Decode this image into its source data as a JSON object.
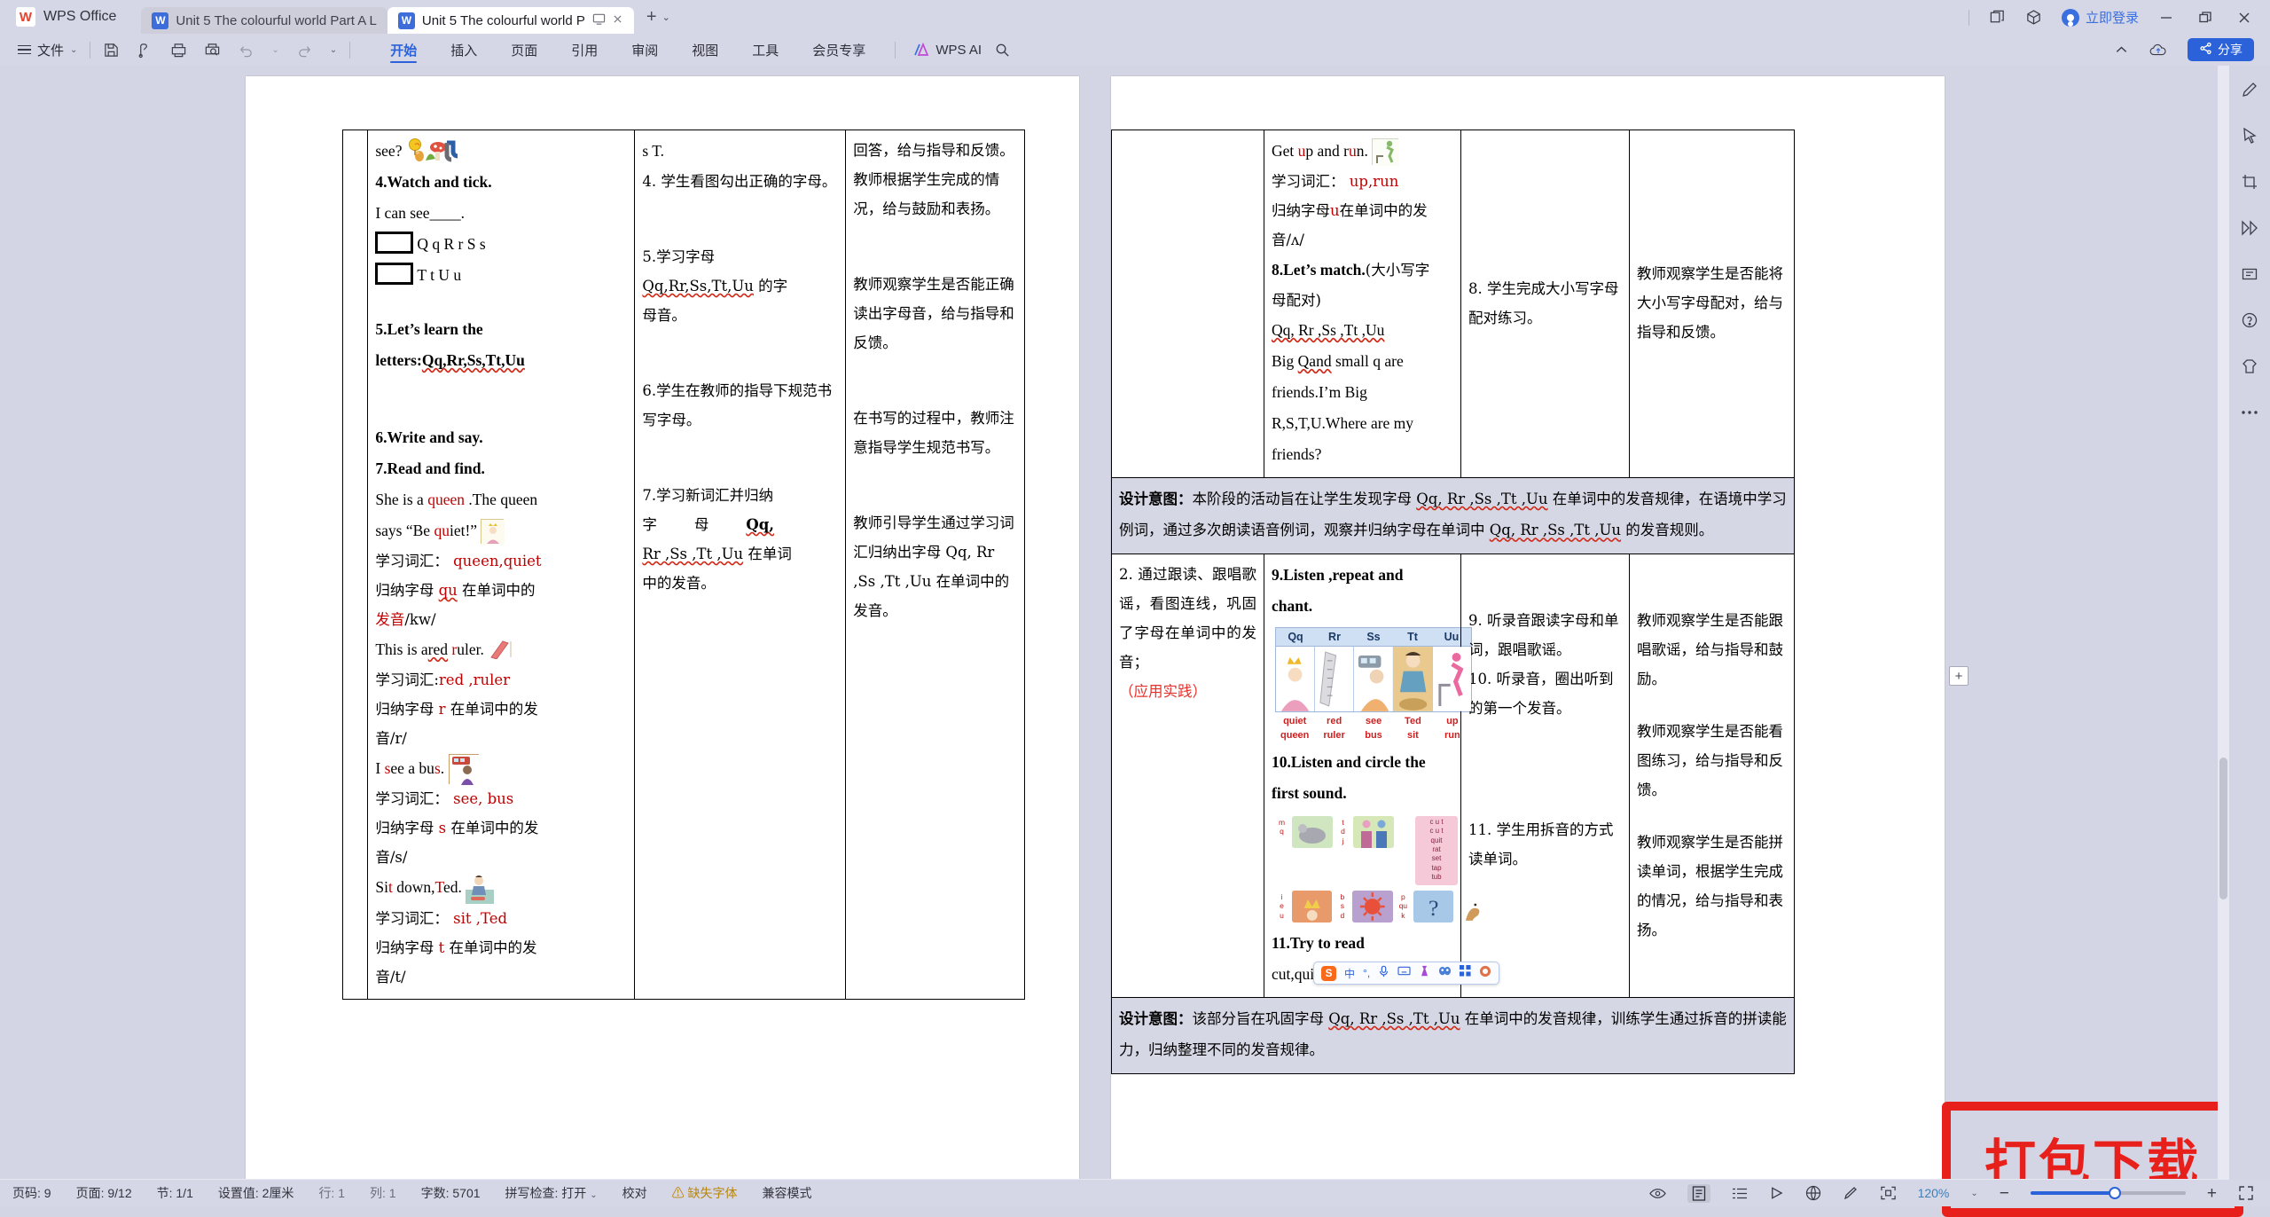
{
  "app": {
    "brand": "WPS Office",
    "logo_glyph": "W",
    "accent": "#2b62d9",
    "titlebar_bg": "#d6d7e6"
  },
  "tabs": [
    {
      "label": "Unit 5 The colourful world Part A L",
      "icon": "word-doc-icon",
      "state": "inactive"
    },
    {
      "label": "Unit 5 The colourful world P",
      "icon": "word-doc-icon",
      "state": "active"
    }
  ],
  "titlebar_right": {
    "login_label": "立即登录",
    "icons": [
      "window-clone-icon",
      "cube-icon",
      "minimize-icon",
      "restore-icon",
      "close-icon"
    ]
  },
  "ribbon": {
    "file_label": "文件",
    "quick_icons": [
      "save-icon",
      "save-as-icon",
      "print-icon",
      "print-preview-icon",
      "undo-icon",
      "redo-icon",
      "more-chevron-icon"
    ],
    "tabs": [
      {
        "label": "开始",
        "selected": true
      },
      {
        "label": "插入",
        "selected": false
      },
      {
        "label": "页面",
        "selected": false
      },
      {
        "label": "引用",
        "selected": false
      },
      {
        "label": "审阅",
        "selected": false
      },
      {
        "label": "视图",
        "selected": false
      },
      {
        "label": "工具",
        "selected": false
      },
      {
        "label": "会员专享",
        "selected": false
      }
    ],
    "ai_label": "WPS AI",
    "search_icon": "search-icon",
    "collapse_icon": "chevron-up-icon",
    "share_label": "分享",
    "upload_icon": "cloud-upload-icon"
  },
  "right_rail": {
    "icons": [
      "pencil-edit-icon",
      "cursor-select-icon",
      "crop-icon",
      "shapes-icon",
      "text-box-icon",
      "help-icon",
      "skin-icon",
      "more-dots-icon"
    ]
  },
  "left_page": {
    "col_a": [
      {
        "type": "en",
        "text": "see?",
        "clipart": "q-lollipop-mouse,r-mushroom,u-magnet"
      },
      {
        "type": "en-b",
        "text": "4.Watch and tick."
      },
      {
        "type": "en",
        "text": "I can see____."
      },
      {
        "type": "tick",
        "text": "Q q R r S s"
      },
      {
        "type": "tick",
        "text": "T t U u"
      },
      {
        "type": "spacer"
      },
      {
        "type": "en-b",
        "text": "5.Let’s learn the"
      },
      {
        "type": "en-b-squig",
        "prefix": "letters:",
        "text": "Qq,Rr,Ss,Tt,Uu"
      },
      {
        "type": "spacer-lg"
      },
      {
        "type": "en-b",
        "text": "6.Write and say."
      },
      {
        "type": "en-b",
        "text": "7.Read and find."
      },
      {
        "type": "en-mix",
        "parts": [
          [
            "She is a ",
            "k"
          ],
          [
            "queen",
            "r"
          ],
          [
            " .The queen",
            "k"
          ]
        ]
      },
      {
        "type": "en-mix",
        "parts": [
          [
            "says “Be ",
            "k"
          ],
          [
            "qu",
            "r"
          ],
          [
            "iet!”",
            "k"
          ]
        ],
        "clipart": "queen"
      },
      {
        "type": "cn-mix",
        "parts": [
          [
            "学习词汇：  ",
            "k"
          ],
          [
            "queen,quiet",
            "r"
          ]
        ]
      },
      {
        "type": "cn-mix",
        "parts": [
          [
            "归纳字母 ",
            "k"
          ],
          [
            "qu",
            "r"
          ],
          [
            " 在单词中的",
            "k"
          ]
        ]
      },
      {
        "type": "cn-mix",
        "parts": [
          [
            "发音",
            "r"
          ],
          [
            "/kw/",
            "k"
          ]
        ]
      },
      {
        "type": "en-mix",
        "parts": [
          [
            "This is a",
            "k"
          ],
          [
            "red ",
            "r"
          ],
          [
            "r",
            "r"
          ],
          [
            "uler.",
            "k"
          ]
        ],
        "clipart": "red-ruler"
      },
      {
        "type": "cn-mix",
        "parts": [
          [
            "学习词汇:",
            "k"
          ],
          [
            "red ,ruler",
            "r"
          ]
        ]
      },
      {
        "type": "cn-mix",
        "parts": [
          [
            "归纳字母 ",
            "k"
          ],
          [
            "r",
            "r"
          ],
          [
            " 在单词中的发",
            "k"
          ]
        ]
      },
      {
        "type": "cn",
        "text": "音/r/"
      },
      {
        "type": "en-mix",
        "parts": [
          [
            "I ",
            "k"
          ],
          [
            "s",
            "r"
          ],
          [
            "ee a bu",
            "k"
          ],
          [
            "s",
            "r"
          ],
          [
            ".",
            "k"
          ]
        ],
        "clipart": "bus"
      },
      {
        "type": "cn-mix",
        "parts": [
          [
            "学习词汇：  ",
            "k"
          ],
          [
            "see, bus",
            "r"
          ]
        ]
      },
      {
        "type": "cn-mix",
        "parts": [
          [
            "归纳字母 ",
            "k"
          ],
          [
            "s",
            "r"
          ],
          [
            " 在单词中的发",
            "k"
          ]
        ]
      },
      {
        "type": "cn",
        "text": "音/s/"
      },
      {
        "type": "en-mix",
        "parts": [
          [
            "Si",
            "k"
          ],
          [
            "t",
            "r"
          ],
          [
            " down,",
            "k"
          ],
          [
            "T",
            "r"
          ],
          [
            "ed.",
            "k"
          ]
        ],
        "clipart": "sit-ted"
      },
      {
        "type": "cn-mix",
        "parts": [
          [
            "学习词汇：  ",
            "k"
          ],
          [
            "sit ,Ted",
            "r"
          ]
        ]
      },
      {
        "type": "cn-mix",
        "parts": [
          [
            "归纳字母 ",
            "k"
          ],
          [
            "t",
            "r"
          ],
          [
            " 在单词中的发",
            "k"
          ]
        ]
      },
      {
        "type": "cn",
        "text": "音/t/"
      }
    ],
    "col_b": [
      {
        "type": "en",
        "text": "s T."
      },
      {
        "type": "cn-just",
        "text": "4. 学生看图勾出正确的字母。"
      },
      {
        "type": "spacer-lg"
      },
      {
        "type": "cn",
        "text": "5.学习字母"
      },
      {
        "type": "cn-mix",
        "parts": [
          [
            "Qq,Rr,Ss,Tt,Uu",
            "squig"
          ],
          [
            " 的字母音。",
            "k"
          ]
        ]
      },
      {
        "type": "spacer-lg"
      },
      {
        "type": "cn",
        "text": "6.学生在教师的指导下规范书写字母。"
      },
      {
        "type": "spacer-lg"
      },
      {
        "type": "cn",
        "text": "7.学习新词汇并归纳"
      },
      {
        "type": "cn-just2",
        "text": "字        母        Qq, Rr ,Ss ,Tt ,Uu 在单词中的发音。"
      }
    ],
    "col_c": [
      {
        "type": "cn",
        "text": "回答，给与指导和反馈。"
      },
      {
        "type": "cn",
        "text": "教师根据学生完成的情况，给与鼓励和表扬。"
      },
      {
        "type": "spacer-lg"
      },
      {
        "type": "cn",
        "text": "教师观察学生是否能正确读出字母音，给与指导和反馈。"
      },
      {
        "type": "spacer-lg"
      },
      {
        "type": "cn",
        "text": "在书写的过程中，教师注意指导学生规范书写。"
      },
      {
        "type": "spacer-lg"
      },
      {
        "type": "cn",
        "text": "教师引导学生通过学习词汇归纳出字母 Qq, Rr ,Ss ,Tt ,Uu 在单词中的发音。"
      }
    ]
  },
  "right_page": {
    "col_b_top": [
      {
        "type": "en-mix",
        "parts": [
          [
            "Get ",
            "k"
          ],
          [
            "u",
            "r"
          ],
          [
            "p and r",
            "k"
          ],
          [
            "u",
            "r"
          ],
          [
            "n.",
            "k"
          ]
        ],
        "clipart": "up-run"
      },
      {
        "type": "cn-mix",
        "parts": [
          [
            "学习词汇：  ",
            "k"
          ],
          [
            "up,run",
            "r"
          ]
        ]
      },
      {
        "type": "cn-mix",
        "parts": [
          [
            "归纳字母",
            "k"
          ],
          [
            "u",
            "r"
          ],
          [
            "在单词中的发",
            "k"
          ]
        ]
      },
      {
        "type": "cn",
        "text": "音/ʌ/"
      },
      {
        "type": "mix-b",
        "parts": [
          [
            "8.Let’s match.",
            "b"
          ],
          [
            "(大小写字",
            "k"
          ]
        ]
      },
      {
        "type": "cn",
        "text": "母配对)"
      },
      {
        "type": "en-squig",
        "text": "Qq, Rr ,Ss ,Tt ,Uu"
      },
      {
        "type": "en",
        "text": "Big Qand small q are"
      },
      {
        "type": "en",
        "text": "friends.I’m Big"
      },
      {
        "type": "en",
        "text": "R,S,T,U.Where are my"
      },
      {
        "type": "en",
        "text": "friends?"
      }
    ],
    "col_c_top": [
      {
        "type": "cn",
        "text": "8. 学生完成大小写字母配对练习。"
      }
    ],
    "col_d_top": [
      {
        "type": "cn",
        "text": "教师观察学生是否能将大小写字母配对，给与指导和反馈。"
      }
    ],
    "intent_1": {
      "label": "设计意图：",
      "text": "本阶段的活动旨在让学生发现字母 Qq, Rr ,Ss ,Tt ,Uu 在单词中的发音规律，在语境中学习例词，通过多次朗读语音例词，观察并归纳字母在单词中 Qq, Rr ,Ss ,Tt ,Uu 的发音规则。"
    },
    "col_a_mid": [
      {
        "type": "cn-just",
        "text": "2. 通过跟读、跟唱歌谣，看图连线，巩固了字母在单词中的发音；"
      },
      {
        "type": "cn-red",
        "text": "（应用实践）"
      }
    ],
    "col_b_mid": [
      {
        "type": "en-b",
        "text": "9.Listen ,repeat and"
      },
      {
        "type": "en-b",
        "text": "chant."
      },
      {
        "type": "chart"
      },
      {
        "type": "en-b",
        "text": "10.Listen and circle the"
      },
      {
        "type": "en-b",
        "text": "first sound."
      },
      {
        "type": "soundgrid"
      },
      {
        "type": "en-b",
        "text": "11.Try to read"
      },
      {
        "type": "en",
        "text": "cut,quit,rat,set,tap,tub."
      }
    ],
    "col_c_mid": [
      {
        "type": "cn",
        "text": "9. 听录音跟读字母和单词，跟唱歌谣。"
      },
      {
        "type": "cn",
        "text": "10. 听录音，圈出听到的第一个发音。"
      },
      {
        "type": "spacer-lg"
      },
      {
        "type": "cn",
        "text": "11. 学生用拆音的方式读单词。"
      }
    ],
    "col_d_mid": [
      {
        "type": "cn",
        "text": "教师观察学生是否能跟唱歌谣，给与指导和鼓励。"
      },
      {
        "type": "cn",
        "text": "教师观察学生是否能看图练习，给与指导和反馈。"
      },
      {
        "type": "cn",
        "text": "教师观察学生是否能拼读单词，根据学生完成的情况，给与指导和表扬。"
      }
    ],
    "intent_2": {
      "label": "设计意图：",
      "text": "该部分旨在巩固字母 Qq, Rr ,Ss ,Tt ,Uu 在单词中的发音规律，训练学生通过拆音的拼读能力，归纳整理不同的发音规律。"
    },
    "letter_chart": {
      "headers": [
        "Qq",
        "Rr",
        "Ss",
        "Tt",
        "Uu"
      ],
      "words": [
        [
          "quiet",
          "queen"
        ],
        [
          "red",
          "ruler"
        ],
        [
          "see",
          "bus"
        ],
        [
          "Ted",
          "sit"
        ],
        [
          "up",
          "run"
        ]
      ]
    },
    "sound_grid": {
      "tall_card_letters": [
        "c u t",
        "c u t",
        "quit",
        "rat",
        "set",
        "tap",
        "tub"
      ],
      "row1_letters": [
        [
          "m",
          "q"
        ],
        [
          "t",
          "d",
          "j"
        ]
      ],
      "row2_letters": [
        [
          "i",
          "e",
          "u"
        ],
        [
          "b",
          "s",
          "d"
        ],
        [
          "p",
          "qu",
          "k"
        ]
      ]
    },
    "ime": {
      "logo": "S",
      "items": [
        "中",
        "°,",
        "mic-icon",
        "keyboard-icon",
        "dress-icon",
        "emoji-icon",
        "apps-icon",
        "toolbox-icon"
      ]
    },
    "insert_row_handle": "+"
  },
  "stamp": {
    "text": "打包下载",
    "color": "#e8201c"
  },
  "statusbar": {
    "items": [
      {
        "label": "页码: 9"
      },
      {
        "label": "页面: 9/12"
      },
      {
        "label": "节: 1/1"
      },
      {
        "label": "设置值: 2厘米"
      },
      {
        "label": "行: 1",
        "dim": true
      },
      {
        "label": "列: 1",
        "dim": true
      },
      {
        "label": "字数: 5701"
      },
      {
        "label": "拼写检查: 打开"
      },
      {
        "label": "校对"
      },
      {
        "label": "缺失字体",
        "warn": true
      },
      {
        "label": "兼容模式"
      }
    ],
    "right_icons": [
      "eye-icon",
      "page-view-icon",
      "outline-view-icon",
      "play-icon",
      "web-view-icon",
      "highlighter-icon",
      "fit-page-icon"
    ],
    "zoom": "120%",
    "zoom_minus": "−",
    "zoom_plus": "+",
    "fullscreen_icon": "fullscreen-icon"
  }
}
